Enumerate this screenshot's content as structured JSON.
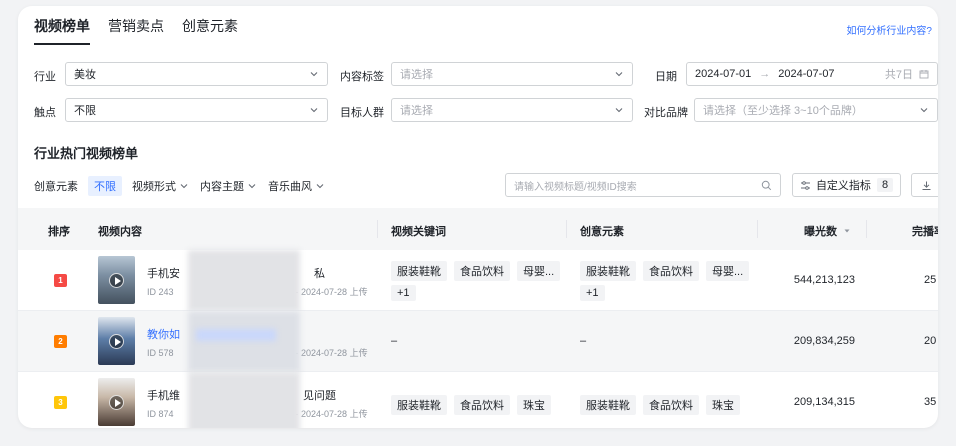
{
  "tabs": [
    "视频榜单",
    "营销卖点",
    "创意元素"
  ],
  "help_link": "如何分析行业内容?",
  "filters": {
    "industry": {
      "label": "行业",
      "value": "美妆"
    },
    "content_tag": {
      "label": "内容标签",
      "placeholder": "请选择"
    },
    "date": {
      "label": "日期",
      "start": "2024-07-01",
      "arrow": "→",
      "end": "2024-07-07",
      "span": "共7日"
    },
    "touchpoint": {
      "label": "触点",
      "value": "不限"
    },
    "audience": {
      "label": "目标人群",
      "placeholder": "请选择"
    },
    "brand_compare": {
      "label": "对比品牌",
      "placeholder": "请选择（至少选择 3~10个品牌）"
    }
  },
  "section_title": "行业热门视频榜单",
  "toolbar": {
    "creative_label": "创意元素",
    "creative_value": "不限",
    "format": "视频形式",
    "theme": "内容主题",
    "music": "音乐曲风",
    "search_placeholder": "请输入视频标题/视频ID搜索",
    "custom_metrics": "自定义指标",
    "metric_count": "8"
  },
  "columns": {
    "rank": "排序",
    "content": "视频内容",
    "keywords": "视频关键词",
    "creative": "创意元素",
    "exposure": "曝光数",
    "completion": "完播率"
  },
  "rows": [
    {
      "rank": "1",
      "rank_color": "#f54a45",
      "title_start": "手机安",
      "title_end": "私",
      "id_prefix": "ID 243",
      "date": "· 2024-07-28 上传",
      "keywords": [
        "服装鞋靴",
        "食品饮料",
        "母婴...",
        "+1"
      ],
      "creative": [
        "服装鞋靴",
        "食品饮料",
        "母婴...",
        "+1"
      ],
      "exposure": "544,213,123",
      "completion": "25"
    },
    {
      "rank": "2",
      "rank_color": "#ff7d00",
      "title_start": "教你如",
      "title_end": "",
      "id_prefix": "ID 578",
      "date": "· 2024-07-28 上传",
      "keywords_dash": "–",
      "creative_dash": "–",
      "exposure": "209,834,259",
      "completion": "20"
    },
    {
      "rank": "3",
      "rank_color": "#ffc60a",
      "title_start": "手机维",
      "title_end": "见问题",
      "id_prefix": "ID 874",
      "date": "· 2024-07-28 上传",
      "keywords": [
        "服装鞋靴",
        "食品饮料",
        "珠宝"
      ],
      "creative": [
        "服装鞋靴",
        "食品饮料",
        "珠宝"
      ],
      "exposure": "209,134,315",
      "completion": "35"
    }
  ]
}
